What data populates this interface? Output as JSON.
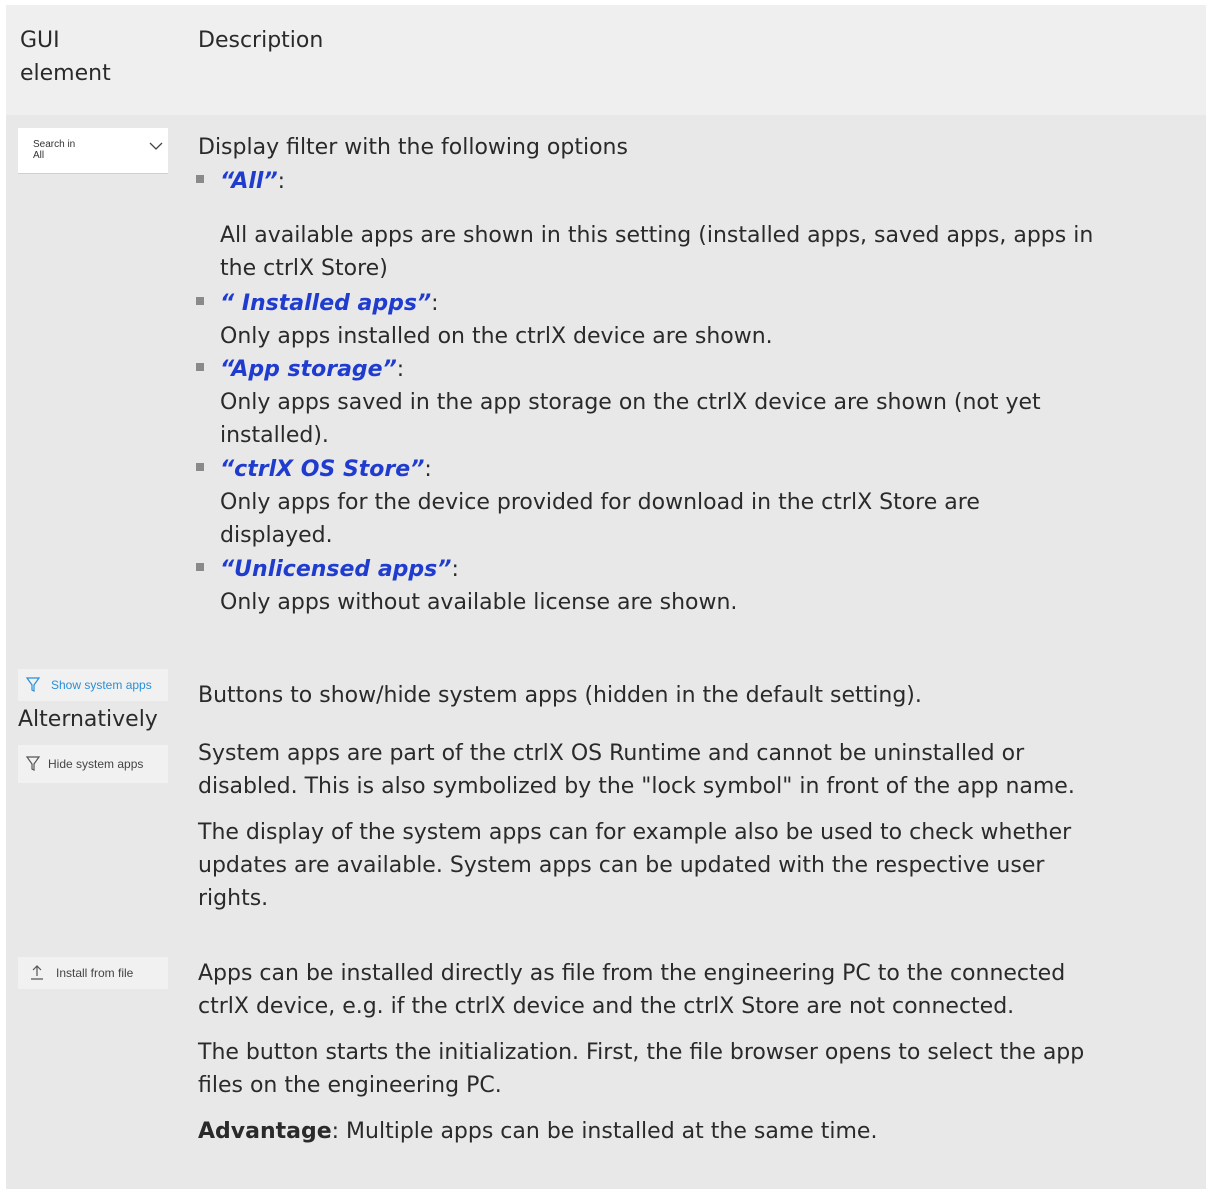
{
  "header": {
    "gui_col": "GUI element",
    "desc_col": "Description"
  },
  "row1": {
    "search": {
      "label": "Search in",
      "value": "All"
    },
    "intro": "Display filter with the following options",
    "options": [
      {
        "name": "“All”",
        "colon": ":",
        "lines": [
          "All available apps are shown in this setting (installed apps, saved apps, apps in",
          "the ctrlX Store)"
        ]
      },
      {
        "name": "“ Installed apps”",
        "colon": ":",
        "lines": [
          "Only apps installed on the ctrlX device are shown."
        ]
      },
      {
        "name": "“App storage”",
        "colon": ":",
        "lines": [
          "Only apps saved in the app storage on the ctrlX device are shown (not yet",
          "installed)."
        ]
      },
      {
        "name": "“ctrlX OS Store”",
        "colon": ":",
        "lines": [
          "Only apps for the device provided for download in the ctrlX Store are",
          "displayed."
        ]
      },
      {
        "name": "“Unlicensed apps”",
        "colon": ":",
        "lines": [
          "Only apps without available license are shown."
        ]
      }
    ]
  },
  "row2": {
    "show_button": "Show system apps",
    "alternatively": "Alternatively",
    "hide_button": "Hide system apps",
    "p1": "Buttons to show/hide system apps (hidden in the default setting).",
    "p2": [
      "System apps are part of the ctrlX OS Runtime and cannot be uninstalled or",
      "disabled. This is also symbolized by the \"lock symbol\" in front of the app name."
    ],
    "p3": [
      "The display of the system apps can for example also be used to check whether",
      "updates are available. System apps can be updated with the respective user",
      "rights."
    ]
  },
  "row3": {
    "install_button": "Install from file",
    "p1": [
      "Apps can be installed directly as file from the engineering PC to the connected",
      "ctrlX device, e.g. if the ctrlX device and the ctrlX Store are not connected."
    ],
    "p2": [
      "The button starts the initialization. First, the file browser opens to select the app",
      "files on the engineering PC."
    ],
    "p3_strong": "Advantage",
    "p3_rest": ": Multiple apps can be installed at the same time."
  },
  "colors": {
    "link": "#1f3ccf",
    "accent": "#2a8fd6",
    "table_bg": "#e8e8e8",
    "header_bg": "#efefef"
  }
}
